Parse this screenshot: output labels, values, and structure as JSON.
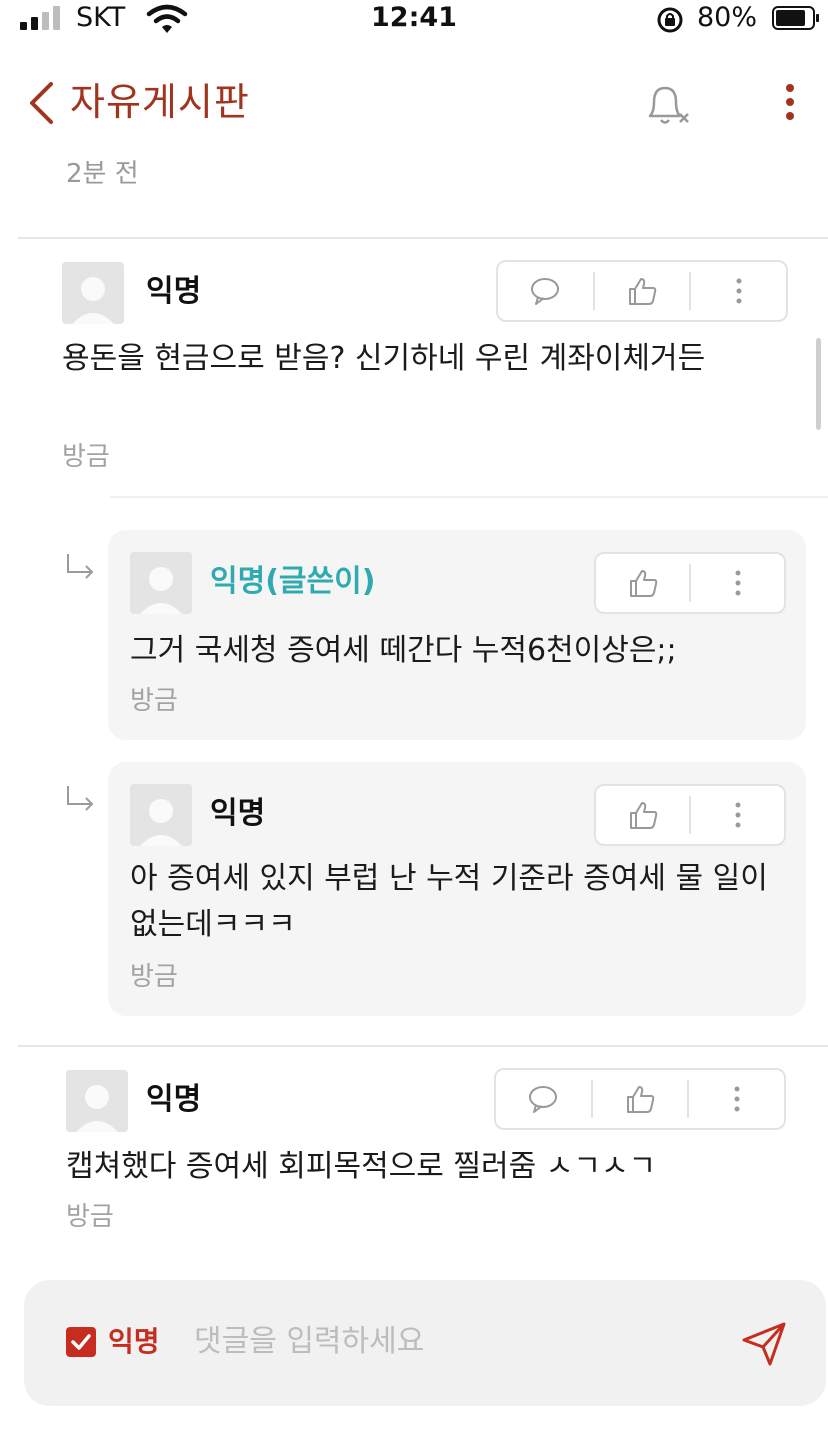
{
  "status_bar": {
    "carrier": "SKT",
    "time": "12:41",
    "battery": "80%"
  },
  "nav": {
    "title": "자유게시판",
    "icons": [
      "back-chevron-icon",
      "bell-off-icon",
      "more-vertical-icon"
    ]
  },
  "post": {
    "time": "2분 전"
  },
  "comments": [
    {
      "author": "익명",
      "text": "용돈을 현금으로 받음? 신기하네 우린 계좌이체거든",
      "time": "방금",
      "actions": [
        "comment-icon",
        "like-icon",
        "more-icon"
      ]
    },
    {
      "author": "익명(글쓴이)",
      "text": "그거 국세청 증여세 떼간다 누적6천이상은;;",
      "time": "방금",
      "is_reply": true,
      "is_op": true,
      "actions": [
        "like-icon",
        "more-icon"
      ]
    },
    {
      "author": "익명",
      "text": "아 증여세 있지 부럽 난 누적 기준라 증여세 물 일이 없는데ㅋㅋㅋ",
      "time": "방금",
      "is_reply": true,
      "actions": [
        "like-icon",
        "more-icon"
      ]
    },
    {
      "author": "익명",
      "text": "캡쳐했다 증여세 회피목적으로 찔러줌 ㅅㄱㅅㄱ",
      "time": "방금",
      "actions": [
        "comment-icon",
        "like-icon",
        "more-icon"
      ]
    }
  ],
  "comment_input": {
    "anonymous_label": "익명",
    "anonymous_checked": true,
    "placeholder": "댓글을 입력하세요"
  },
  "colors": {
    "accent": "#a1341e",
    "checkbox": "#c62d1f",
    "op_author": "#2eaab0",
    "reply_bg": "#f5f5f5"
  }
}
